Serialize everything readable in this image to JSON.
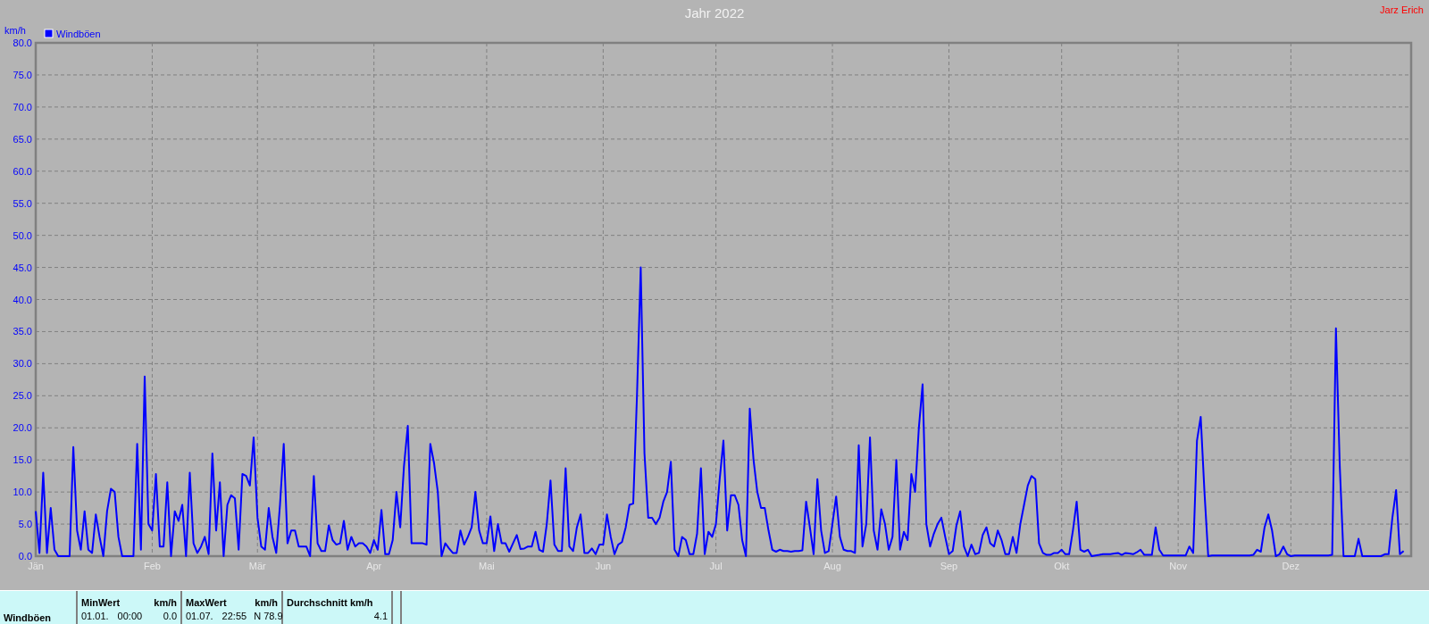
{
  "header": {
    "title": "Jahr 2022",
    "author": "Jarz Erich"
  },
  "chart": {
    "chart_data": {
      "type": "line",
      "grid": true,
      "ylabel": "km/h",
      "ylim": [
        0,
        80
      ],
      "categories": [
        "Jän",
        null,
        null,
        null,
        null,
        null,
        null,
        null,
        null,
        null,
        null,
        null,
        null,
        null,
        null,
        null,
        null,
        null,
        null,
        null,
        null,
        null,
        null,
        null,
        null,
        null,
        null,
        null,
        null,
        null,
        null,
        "Feb",
        null,
        null,
        null,
        null,
        null,
        null,
        null,
        null,
        null,
        null,
        null,
        null,
        null,
        null,
        null,
        null,
        null,
        null,
        null,
        null,
        null,
        null,
        null,
        null,
        null,
        null,
        null,
        "Mär",
        null,
        null,
        null,
        null,
        null,
        null,
        null,
        null,
        null,
        null,
        null,
        null,
        null,
        null,
        null,
        null,
        null,
        null,
        null,
        null,
        null,
        null,
        null,
        null,
        null,
        null,
        null,
        null,
        null,
        null,
        "Apr",
        null,
        null,
        null,
        null,
        null,
        null,
        null,
        null,
        null,
        null,
        null,
        null,
        null,
        null,
        null,
        null,
        null,
        null,
        null,
        null,
        null,
        null,
        null,
        null,
        null,
        null,
        null,
        null,
        null,
        "Mai",
        null,
        null,
        null,
        null,
        null,
        null,
        null,
        null,
        null,
        null,
        null,
        null,
        null,
        null,
        null,
        null,
        null,
        null,
        null,
        null,
        null,
        null,
        null,
        null,
        null,
        null,
        null,
        null,
        null,
        null,
        "Jun",
        null,
        null,
        null,
        null,
        null,
        null,
        null,
        null,
        null,
        null,
        null,
        null,
        null,
        null,
        null,
        null,
        null,
        null,
        null,
        null,
        null,
        null,
        null,
        null,
        null,
        null,
        null,
        null,
        null,
        "Jul",
        null,
        null,
        null,
        null,
        null,
        null,
        null,
        null,
        null,
        null,
        null,
        null,
        null,
        null,
        null,
        null,
        null,
        null,
        null,
        null,
        null,
        null,
        null,
        null,
        null,
        null,
        null,
        null,
        null,
        null,
        "Aug",
        null,
        null,
        null,
        null,
        null,
        null,
        null,
        null,
        null,
        null,
        null,
        null,
        null,
        null,
        null,
        null,
        null,
        null,
        null,
        null,
        null,
        null,
        null,
        null,
        null,
        null,
        null,
        null,
        null,
        null,
        "Sep",
        null,
        null,
        null,
        null,
        null,
        null,
        null,
        null,
        null,
        null,
        null,
        null,
        null,
        null,
        null,
        null,
        null,
        null,
        null,
        null,
        null,
        null,
        null,
        null,
        null,
        null,
        null,
        null,
        null,
        "Okt",
        null,
        null,
        null,
        null,
        null,
        null,
        null,
        null,
        null,
        null,
        null,
        null,
        null,
        null,
        null,
        null,
        null,
        null,
        null,
        null,
        null,
        null,
        null,
        null,
        null,
        null,
        null,
        null,
        null,
        null,
        "Nov",
        null,
        null,
        null,
        null,
        null,
        null,
        null,
        null,
        null,
        null,
        null,
        null,
        null,
        null,
        null,
        null,
        null,
        null,
        null,
        null,
        null,
        null,
        null,
        null,
        null,
        null,
        null,
        null,
        null,
        "Dez",
        null,
        null,
        null,
        null,
        null,
        null,
        null,
        null,
        null,
        null,
        null,
        null,
        null,
        null,
        null,
        null,
        null,
        null,
        null,
        null,
        null,
        null,
        null,
        null,
        null,
        null,
        null,
        null,
        null,
        null
      ],
      "yticks": [
        {
          "value": 0,
          "label": "0.0"
        },
        {
          "value": 5,
          "label": "5.0"
        },
        {
          "value": 10,
          "label": "10.0"
        },
        {
          "value": 15,
          "label": "15.0"
        },
        {
          "value": 20,
          "label": "20.0"
        },
        {
          "value": 25,
          "label": "25.0"
        },
        {
          "value": 30,
          "label": "30.0"
        },
        {
          "value": 35,
          "label": "35.0"
        },
        {
          "value": 40,
          "label": "40.0"
        },
        {
          "value": 45,
          "label": "45.0"
        },
        {
          "value": 50,
          "label": "50.0"
        },
        {
          "value": 55,
          "label": "55.0"
        },
        {
          "value": 60,
          "label": "60.0"
        },
        {
          "value": 65,
          "label": "65.0"
        },
        {
          "value": 70,
          "label": "70.0"
        },
        {
          "value": 75,
          "label": "75.0"
        },
        {
          "value": 80,
          "label": "80.0"
        }
      ],
      "series": [
        {
          "name": "Windböen",
          "color": "#0000ff",
          "values": [
            7,
            0.5,
            13,
            0.5,
            7.5,
            1,
            0,
            0,
            0,
            0,
            17,
            4,
            1,
            7,
            1,
            0.5,
            6.5,
            3,
            0,
            7,
            10.5,
            10,
            3,
            0,
            0,
            0,
            0,
            17.5,
            1,
            28,
            5,
            4,
            12.8,
            1.5,
            1.5,
            11.5,
            0,
            7,
            5.5,
            8,
            0,
            13,
            2,
            0.5,
            1.5,
            3,
            0.3,
            16,
            4,
            11.5,
            0,
            8,
            9.5,
            9,
            1,
            12.8,
            12.5,
            11,
            18.5,
            6,
            1.5,
            1,
            7.5,
            3,
            0.5,
            8,
            17.5,
            2,
            4,
            4,
            1.5,
            1.5,
            1.5,
            0,
            12.5,
            2,
            0.8,
            0.8,
            4.8,
            2.5,
            1.8,
            2,
            5.5,
            1,
            3,
            1.5,
            2,
            2,
            1.5,
            0.5,
            2.5,
            1,
            7.2,
            0.3,
            0.3,
            2.5,
            10,
            4.5,
            14,
            20.3,
            2,
            2,
            2,
            2,
            1.8,
            17.5,
            14.5,
            10,
            0,
            2,
            1.2,
            0.5,
            0.5,
            4,
            1.8,
            3,
            4.5,
            10,
            4,
            2,
            2,
            6.2,
            0.8,
            5,
            2,
            2,
            0.7,
            2,
            3.3,
            1.1,
            1.2,
            1.5,
            1.5,
            3.8,
            1,
            0.7,
            5,
            11.8,
            1.8,
            0.8,
            0.8,
            13.7,
            1.5,
            0.8,
            4.5,
            6.5,
            0.5,
            0.5,
            1.2,
            0.3,
            1.8,
            1.8,
            6.5,
            3,
            0.3,
            1.8,
            2.2,
            4.5,
            8,
            8.2,
            25,
            45,
            16,
            6,
            6,
            5,
            6,
            8.5,
            10,
            14.7,
            1,
            0,
            3,
            2.5,
            0.3,
            0.3,
            3.5,
            13.7,
            0.3,
            3.8,
            3,
            5,
            12,
            18,
            4,
            9.5,
            9.5,
            8,
            2.5,
            0,
            23,
            15,
            10,
            7.5,
            7.5,
            4,
            1,
            0.7,
            1,
            0.8,
            0.8,
            0.7,
            0.8,
            0.8,
            0.9,
            8.5,
            4.5,
            0.3,
            12,
            4,
            0.5,
            0.8,
            5,
            9.3,
            3,
            1,
            0.8,
            0.8,
            0.5,
            17.3,
            1.5,
            5,
            18.5,
            4,
            1,
            7.3,
            5,
            1,
            3,
            15,
            1,
            3.8,
            2.5,
            12.8,
            10,
            20,
            26.8,
            5,
            1.5,
            3.5,
            5,
            6,
            3,
            0.3,
            0.8,
            4.8,
            7,
            1.5,
            0,
            1.8,
            0.3,
            0.5,
            3.3,
            4.5,
            2,
            1.5,
            4,
            2.5,
            0.3,
            0.3,
            3,
            0.5,
            5,
            8,
            11,
            12.5,
            12,
            2,
            0.5,
            0.2,
            0.2,
            0.5,
            0.5,
            1,
            0.3,
            0.3,
            4,
            8.5,
            1,
            0.7,
            1,
            0,
            0.1,
            0.2,
            0.3,
            0.3,
            0.3,
            0.4,
            0.5,
            0.2,
            0.5,
            0.4,
            0.3,
            0.6,
            1,
            0.2,
            0.2,
            0.2,
            4.5,
            1,
            0.1,
            0.1,
            0.1,
            0.1,
            0.1,
            0.1,
            0.1,
            1.5,
            0.5,
            18,
            21.7,
            10,
            0,
            0.1,
            0.1,
            0.1,
            0.1,
            0.1,
            0.1,
            0.1,
            0.1,
            0.1,
            0.1,
            0.1,
            0.2,
            1,
            0.7,
            4.5,
            6.5,
            4,
            0,
            0.3,
            1.5,
            0.3,
            0,
            0.1,
            0.1,
            0.1,
            0.1,
            0.1,
            0.1,
            0.1,
            0.1,
            0.1,
            0.1,
            0.2,
            35.5,
            14,
            0,
            0,
            0,
            0,
            2.7,
            0,
            0,
            0,
            0,
            0,
            0,
            0.3,
            0.3,
            6,
            10.3,
            0.3,
            0.8
          ]
        }
      ]
    }
  },
  "summary": {
    "row_label": "Windböen",
    "columns": [
      {
        "heading": "MinWert",
        "unit": "km/h",
        "date": "01.01.",
        "time": "00:00",
        "value": "0.0"
      },
      {
        "heading": "MaxWert",
        "unit": "km/h",
        "date": "01.07.",
        "time": "22:55",
        "value": "N 78.9"
      },
      {
        "heading": "Durchschnitt km/h",
        "value": "4.1"
      }
    ]
  }
}
